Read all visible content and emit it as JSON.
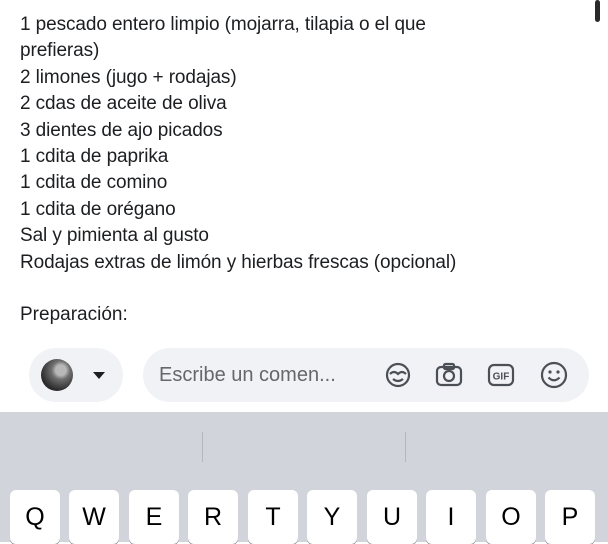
{
  "post": {
    "lines": [
      "1 pescado entero limpio (mojarra, tilapia o el que",
      "prefieras)",
      "2 limones (jugo + rodajas)",
      "2 cdas de aceite de oliva",
      "3 dientes de ajo picados",
      "1 cdita de paprika",
      "1 cdita de comino",
      "1 cdita de orégano",
      "Sal y pimienta al gusto",
      "Rodajas extras de limón y hierbas frescas (opcional)"
    ],
    "preparation_heading": "Preparación:"
  },
  "composer": {
    "placeholder": "Escribe un comen...",
    "icons": [
      "avatar-icon-emoji",
      "camera-icon",
      "gif-icon",
      "smiley-icon"
    ]
  },
  "keyboard": {
    "row1": [
      "Q",
      "W",
      "E",
      "R",
      "T",
      "Y",
      "U",
      "I",
      "O",
      "P"
    ]
  }
}
